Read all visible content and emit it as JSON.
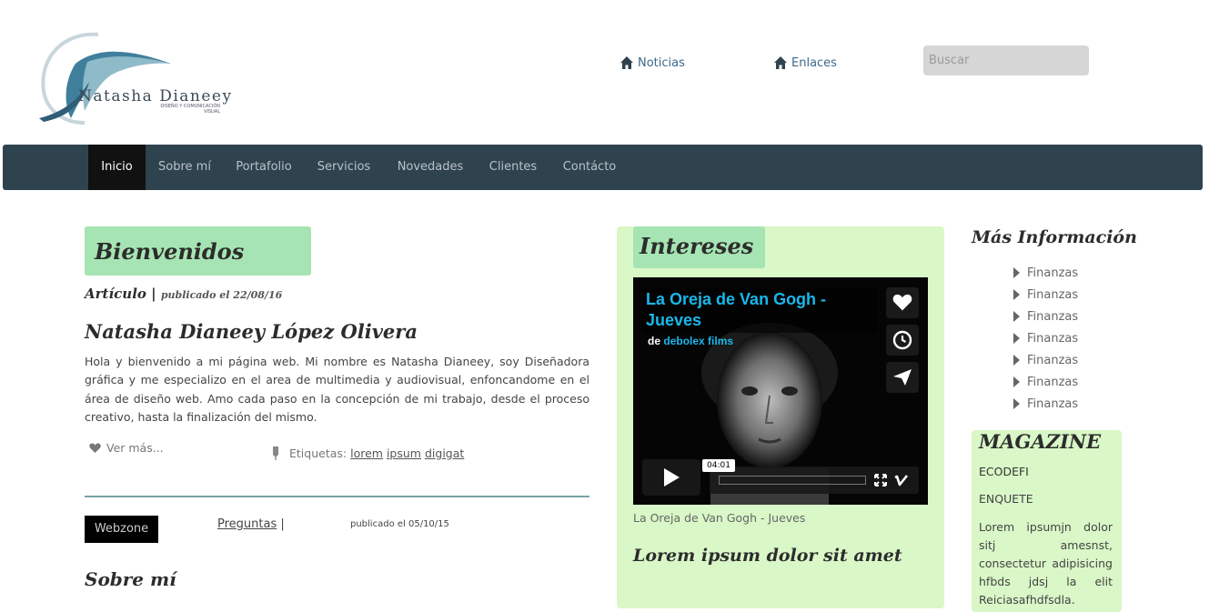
{
  "header": {
    "logo_name": "Natasha Dianeey",
    "logo_tagline": "DISEÑO Y COMUNICACIÓN VISUAL",
    "links": [
      {
        "label": "Noticias",
        "icon": "home-icon"
      },
      {
        "label": "Enlaces",
        "icon": "home-icon"
      }
    ],
    "search_placeholder": "Buscar"
  },
  "nav": {
    "items": [
      "Inicio",
      "Sobre mí",
      "Portafolio",
      "Servicios",
      "Novedades",
      "Clientes",
      "Contácto"
    ],
    "active": "Inicio"
  },
  "main": {
    "title": "Bienvenidos",
    "meta_type": "Artículo",
    "meta_separator": "|",
    "meta_date": "publicado el 22/08/16",
    "heading": "Natasha Dianeey López Olivera",
    "paragraph": "Hola y bienvenido a mi página web. Mi nombre es Natasha Dianeey, soy Diseñadora gráfica y me especializo en el area de multimedia y audiovisual, enfoncandome en el área de diseño web. Amo cada paso en la concepción de mi trabajo, desde el proceso creativo, hasta la finalización del mismo.",
    "read_more": "Ver más...",
    "tags_label": "Etiquetas:",
    "tags": [
      "lorem",
      "ipsum",
      "digigat"
    ],
    "post2_tag": "Webzone",
    "post2_link": "Preguntas",
    "post2_sep": "|",
    "post2_date": "publicado el 05/10/15",
    "next_heading": "Sobre mí"
  },
  "interests": {
    "title": "Intereses",
    "video": {
      "title": "La Oreja de Van Gogh - Jueves",
      "by_prefix": "de",
      "author": "debolex films",
      "time": "04:01",
      "caption": "La Oreja de Van Gogh - Jueves"
    },
    "lorem_heading": "Lorem ipsum dolor sit amet"
  },
  "sidebar": {
    "title": "Más Información",
    "items": [
      "Finanzas",
      "Finanzas",
      "Finanzas",
      "Finanzas",
      "Finanzas",
      "Finanzas",
      "Finanzas"
    ],
    "magazine": {
      "title": "MAGAZINE",
      "line1": "ECODEFI",
      "line2": "ENQUETE",
      "text": "Lorem ipsumjn dolor sitj amesnst, consectetur adipisicing hfbds jdsj la elit Reiciasafhdfsdla."
    }
  },
  "colors": {
    "nav_bg": "#2f434f",
    "title_box": "#a6e5b3",
    "panel_bg": "#d9f7c7",
    "link": "#3d6a8a",
    "vimeo_blue": "#1ab7ea"
  }
}
